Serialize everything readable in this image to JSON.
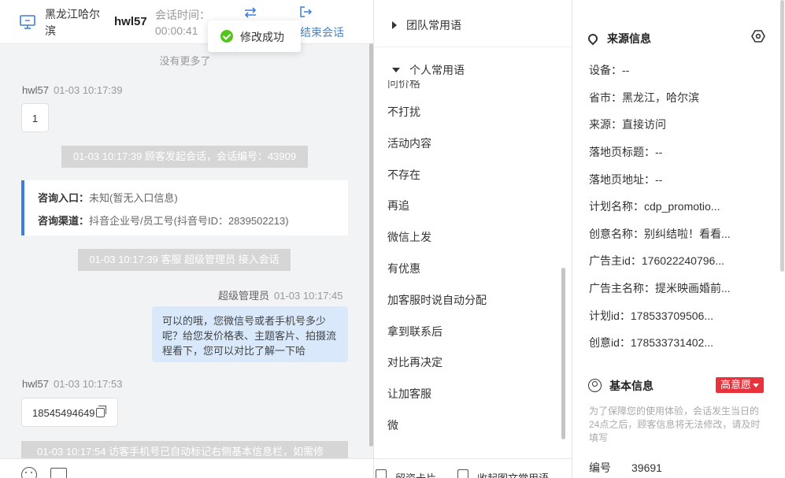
{
  "header": {
    "location": "黑龙江哈尔滨",
    "visitor_name": "hwl57",
    "session_time_label": "会话时间：",
    "session_time": "00:00:41",
    "end_session": "结束会话"
  },
  "toast": {
    "text": "修改成功"
  },
  "chat": {
    "no_more": "没有更多了",
    "msg1": {
      "sender": "hwl57",
      "time": "01-03 10:17:39",
      "text": "1"
    },
    "sys1": "01-03 10:17:39 顾客发起会话，会话编号：43909",
    "entry": {
      "label1": "咨询入口：",
      "value1": "未知(暂无入口信息)",
      "label2": "咨询渠道：",
      "value2": "抖音企业号/员工号(抖音号ID：2839502213)"
    },
    "sys2": "01-03 10:17:39 客服 超级管理员 接入会话",
    "msg2": {
      "sender": "超级管理员",
      "time": "01-03 10:17:45",
      "text": "可以的哦，您微信号或者手机号多少呢？给您发价格表、主题客片、拍摄流程看下，您可以对比了解一下哈"
    },
    "msg3": {
      "sender": "hwl57",
      "time": "01-03 10:17:53",
      "text": "18545494649"
    },
    "sys3": "01-03 10:17:54 访客手机号已自动标记右侧基本信息栏，如需修"
  },
  "phrases": {
    "team_group": "团队常用语",
    "personal_group": "个人常用语",
    "partial_item": "问价格",
    "items": [
      "不打扰",
      "活动内容",
      "不存在",
      "再追",
      "微信上发",
      "有优惠",
      "加客服时说自动分配",
      "拿到联系后",
      "对比再决定",
      "让加客服",
      "微"
    ],
    "footer_card": "留资卡片",
    "footer_collapse": "收起图文常用语"
  },
  "source_info": {
    "title": "来源信息",
    "rows": [
      "设备：--",
      "省市：黑龙江，哈尔滨",
      "来源：直接访问",
      "落地页标题：--",
      "落地页地址：--",
      "计划名称：cdp_promotio...",
      "创意名称：别纠结啦！看看...",
      "广告主id：176022240796...",
      "广告主名称：提米映画婚前...",
      "计划id：178533709506...",
      "创意id：178533731402..."
    ]
  },
  "basic_info": {
    "title": "基本信息",
    "intent_badge": "高意愿",
    "notice": "为了保障您的使用体验，会话发生当日的24点之后，顾客信息将无法修改，请及时填写",
    "id_label": "编号",
    "id_value": "39691"
  },
  "colors": {
    "accent": "#3d7fd6",
    "badge": "#e8323c",
    "success": "#52c41a",
    "out_bubble": "#d9e9fb"
  }
}
